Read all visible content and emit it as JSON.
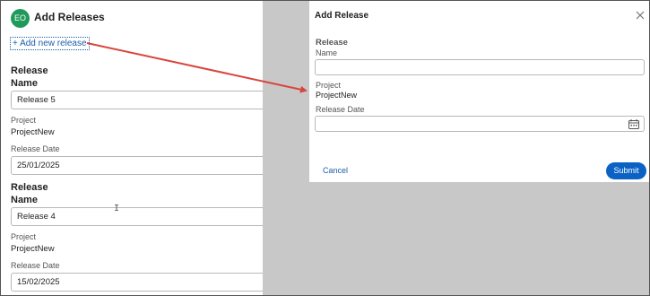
{
  "page": {
    "avatar_initials": "EO",
    "title": "Add Releases",
    "add_link": "+ Add new release"
  },
  "releases": [
    {
      "heading": "Release",
      "name_label": "Name",
      "name_value": "Release 5",
      "project_label": "Project",
      "project_value": "ProjectNew",
      "date_label": "Release Date",
      "date_value": "25/01/2025"
    },
    {
      "heading": "Release",
      "name_label": "Name",
      "name_value": "Release 4",
      "project_label": "Project",
      "project_value": "ProjectNew",
      "date_label": "Release Date",
      "date_value": "15/02/2025"
    }
  ],
  "modal": {
    "title": "Add Release",
    "section_heading": "Release",
    "name_label": "Name",
    "name_value": "",
    "project_label": "Project",
    "project_value": "ProjectNew",
    "date_label": "Release Date",
    "date_value": "",
    "cancel_label": "Cancel",
    "submit_label": "Submit",
    "close_icon": "close-icon",
    "calendar_icon": "calendar-icon"
  },
  "colors": {
    "avatar_bg": "#1f9a5a",
    "link": "#1b5fa8",
    "submit_bg": "#0b62c4",
    "overlay": "#c8c8c8",
    "annotation_arrow": "#d9453d"
  }
}
